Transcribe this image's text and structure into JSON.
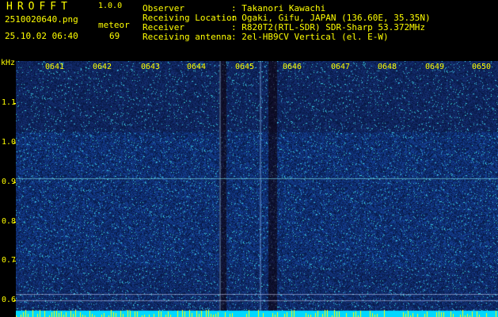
{
  "app": {
    "logo": "HROFFT",
    "version": "1.0.0"
  },
  "file": {
    "name": "2510020640.png",
    "datetime": "25.10.02 06:40"
  },
  "meteor": {
    "label": "meteor",
    "count": "69"
  },
  "info": [
    {
      "key": "Observer",
      "value": ": Takanori Kawachi"
    },
    {
      "key": "Receiving Location",
      "value": ": Ogaki, Gifu, JAPAN (136.60E, 35.35N)"
    },
    {
      "key": "Receiver",
      "value": ": R820T2(RTL-SDR) SDR-Sharp 53.372MHz"
    },
    {
      "key": "Receiving antenna",
      "value": ": 2el-HB9CV Vertical (el. E-W)"
    }
  ],
  "y_axis": {
    "unit": "kHz",
    "ticks": [
      "1.1",
      "1.0",
      "0.9",
      "0.8",
      "0.7",
      "0.6"
    ]
  },
  "x_axis": {
    "ticks": [
      "0641",
      "0642",
      "0643",
      "0644",
      "0645",
      "0646",
      "0647",
      "0648",
      "0649",
      "0650"
    ]
  },
  "colors": {
    "text": "#ffff00",
    "background": "#000000",
    "spectrum": "#1a2f8c",
    "signal": "#66ffff"
  }
}
